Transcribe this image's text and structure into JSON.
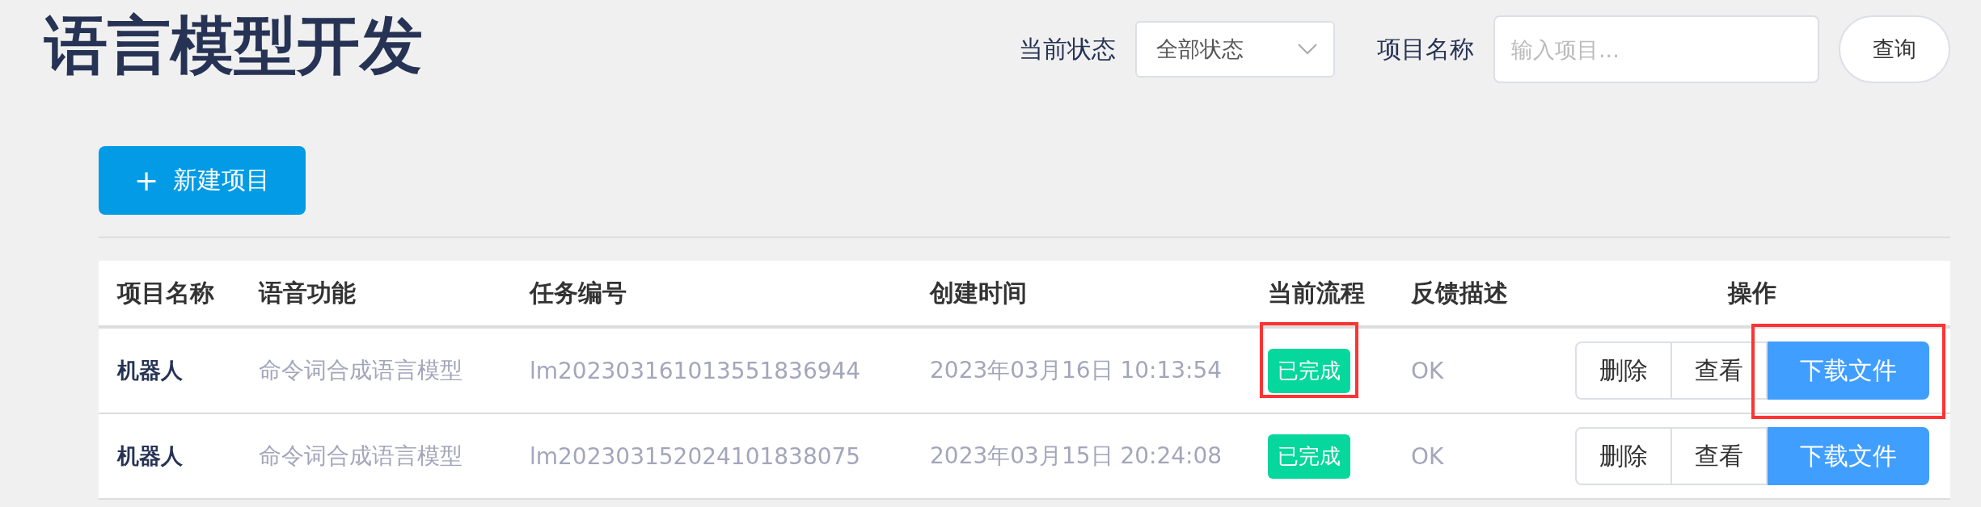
{
  "title": "语言模型开发",
  "filters": {
    "status_label": "当前状态",
    "status_value": "全部状态",
    "name_label": "项目名称",
    "name_placeholder": "输入项目...",
    "query_button": "查询"
  },
  "new_button": {
    "icon": "+",
    "label": "新建项目"
  },
  "table": {
    "columns": [
      "项目名称",
      "语音功能",
      "任务编号",
      "创建时间",
      "当前流程",
      "反馈描述",
      "操作"
    ],
    "rows": [
      {
        "name": "机器人",
        "function": "命令词合成语言模型",
        "task_id": "lm202303161013551836944",
        "created": "2023年03月16日 10:13:54",
        "stage": "已完成",
        "feedback": "OK",
        "actions": [
          "删除",
          "查看",
          "下载文件"
        ],
        "highlighted": true
      },
      {
        "name": "机器人",
        "function": "命令词合成语言模型",
        "task_id": "lm202303152024101838075",
        "created": "2023年03月15日 20:24:08",
        "stage": "已完成",
        "feedback": "OK",
        "actions": [
          "删除",
          "查看",
          "下载文件"
        ],
        "highlighted": false
      }
    ]
  }
}
